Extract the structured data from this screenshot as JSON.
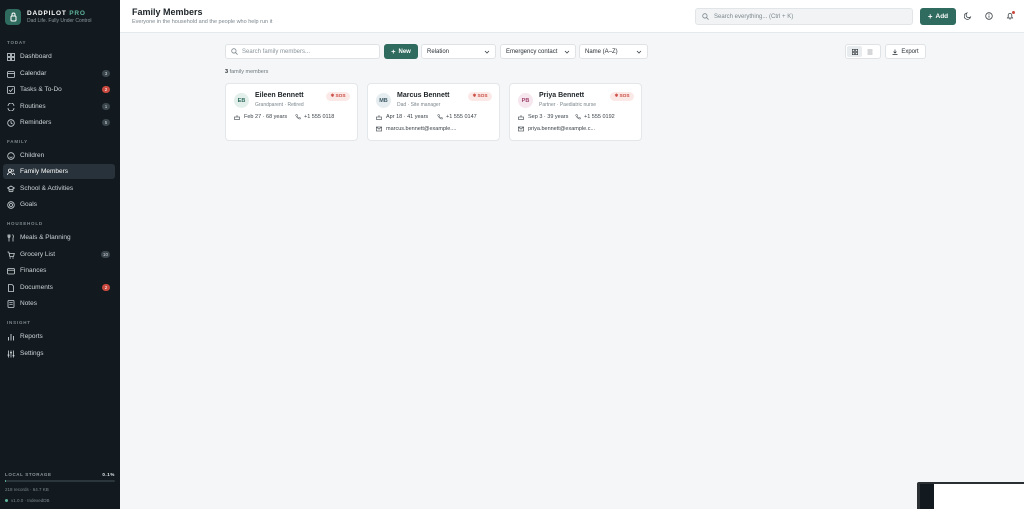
{
  "brand": {
    "name": "DADPILOT",
    "suffix": "PRO",
    "tagline": "Dad Life. Fully Under Control"
  },
  "sidebar": {
    "sections": [
      "TODAY",
      "FAMILY",
      "HOUSEHOLD",
      "INSIGHT"
    ],
    "items": [
      {
        "label": "Dashboard",
        "badge": ""
      },
      {
        "label": "Calendar",
        "badge": "3"
      },
      {
        "label": "Tasks & To-Do",
        "badge": "2"
      },
      {
        "label": "Routines",
        "badge": "1"
      },
      {
        "label": "Reminders",
        "badge": "5"
      },
      {
        "label": "Children",
        "badge": ""
      },
      {
        "label": "Family Members",
        "badge": ""
      },
      {
        "label": "School & Activities",
        "badge": ""
      },
      {
        "label": "Goals",
        "badge": ""
      },
      {
        "label": "Meals & Planning",
        "badge": ""
      },
      {
        "label": "Grocery List",
        "badge": "10"
      },
      {
        "label": "Finances",
        "badge": ""
      },
      {
        "label": "Documents",
        "badge": "2"
      },
      {
        "label": "Notes",
        "badge": ""
      },
      {
        "label": "Reports",
        "badge": ""
      },
      {
        "label": "Settings",
        "badge": ""
      }
    ],
    "storage": {
      "label": "LOCAL STORAGE",
      "percent_text": "0.1%",
      "fill": 0.001,
      "meta": "218 records · 64.7 KB",
      "version": "v1.0.0 · IndexedDB"
    }
  },
  "header": {
    "title": "Family Members",
    "subtitle": "Everyone in the household and the people who help run it",
    "search_placeholder": "Search everything... (Ctrl + K)",
    "add_label": "Add"
  },
  "toolbar": {
    "search_placeholder": "Search family members...",
    "new_label": "New",
    "relation": "Relation",
    "emergency": "Emergency contact",
    "sort": "Name (A–Z)",
    "export": "Export"
  },
  "count": {
    "number": "3",
    "label": "family members"
  },
  "members": [
    {
      "initials": "EB",
      "name": "Eileen Bennett",
      "role": "Grandparent · Retired",
      "sos": "SOS",
      "birthday": "Feb 27 · 68 years",
      "phone": "+1 555 0118",
      "email": ""
    },
    {
      "initials": "MB",
      "name": "Marcus Bennett",
      "role": "Dad · Site manager",
      "sos": "SOS",
      "birthday": "Apr 18 · 41 years",
      "phone": "+1 555 0147",
      "email": "marcus.bennett@example...."
    },
    {
      "initials": "PB",
      "name": "Priya Bennett",
      "role": "Partner · Paediatric nurse",
      "sos": "SOS",
      "birthday": "Sep 3 · 39 years",
      "phone": "+1 555 0192",
      "email": "priya.bennett@example.c..."
    }
  ],
  "colors": {
    "accent": "#2f6b5e",
    "sidebar": "#121a1f",
    "danger": "#c9493f"
  }
}
